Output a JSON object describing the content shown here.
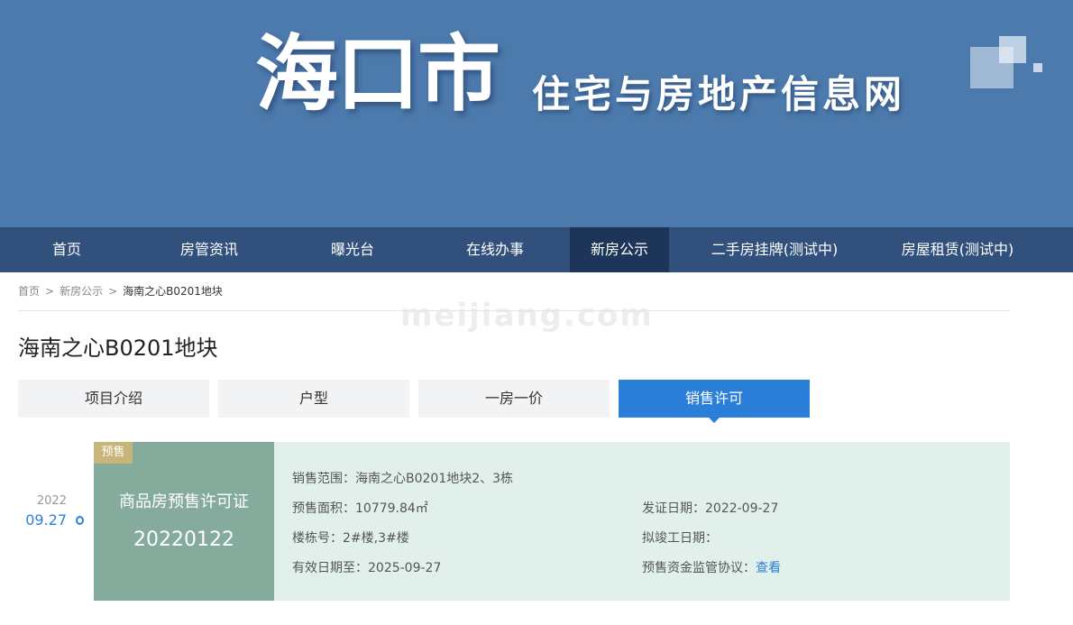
{
  "banner": {
    "city": "海口市",
    "subtitle": "住宅与房地产信息网"
  },
  "nav": [
    {
      "label": "首页"
    },
    {
      "label": "房管资讯"
    },
    {
      "label": "曝光台"
    },
    {
      "label": "在线办事"
    },
    {
      "label": "新房公示",
      "active": true
    },
    {
      "label": "二手房挂牌(测试中)"
    },
    {
      "label": "房屋租赁(测试中)"
    }
  ],
  "breadcrumb": {
    "home": "首页",
    "sep1": ">",
    "section": "新房公示",
    "sep2": ">",
    "current": "海南之心B0201地块"
  },
  "watermark": "meijiang.com",
  "page_title": "海南之心B0201地块",
  "tabs": [
    {
      "label": "项目介绍"
    },
    {
      "label": "户型"
    },
    {
      "label": "一房一价"
    },
    {
      "label": "销售许可",
      "active": true
    }
  ],
  "permit": {
    "year": "2022",
    "date": "09.27",
    "tag": "预售",
    "name": "商品房预售许可证",
    "number": "20220122",
    "scope_label": "销售范围：",
    "scope": "海南之心B0201地块2、3栋",
    "area_label": "预售面积：",
    "area": "10779.84㎡",
    "issue_label": "发证日期：",
    "issue_date": "2022-09-27",
    "building_label": "楼栋号：",
    "building": "2#楼,3#楼",
    "completion_label": "拟竣工日期：",
    "completion": "",
    "valid_label": "有效日期至：",
    "valid_until": "2025-09-27",
    "agreement_label": "预售资金监管协议：",
    "agreement_link": "查看"
  },
  "colors": {
    "banner": "#4c7aac",
    "nav": "#31507c",
    "nav_active": "#1c3558",
    "accent": "#2b7fd9",
    "card_green": "#85ab9c",
    "card_bg": "#e2f0ec",
    "tag": "#c8b57a"
  }
}
